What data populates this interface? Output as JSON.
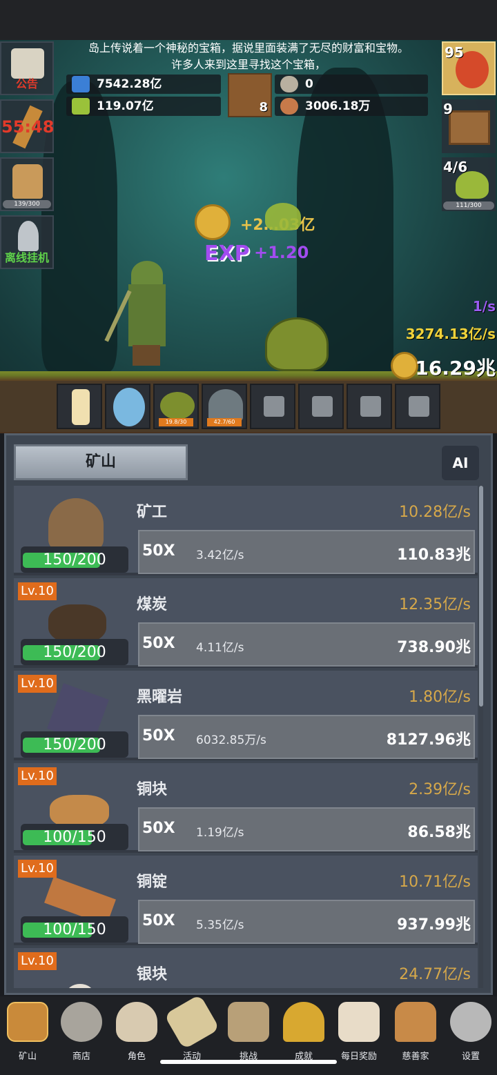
{
  "story": {
    "line1": "岛上传说着一个神秘的宝箱，据说里面装满了无尽的财富和宝物。",
    "line2": "许多人来到这里寻找这个宝箱，"
  },
  "resources": {
    "blue_potion": "7542.28亿",
    "green_potion": "119.07亿",
    "book_count": "8",
    "coin_top": "0",
    "meat": "3006.18万"
  },
  "left_buttons": {
    "notice_label": "公告",
    "timer_label": "55:48",
    "beer_progress": "139/300",
    "offline_label": "离线挂机"
  },
  "right_buttons": {
    "potion_count": "95",
    "chest_count": "9",
    "slime_count": "4/6",
    "slime_progress": "111/300"
  },
  "battle": {
    "gold_float": "+2…03亿",
    "exp_label": "EXP",
    "exp_value": "+1.20",
    "speed": "1/s",
    "gold_rate": "3274.13亿/s",
    "total_gold": "16.29兆"
  },
  "slots": [
    {
      "name": "candle"
    },
    {
      "name": "egg"
    },
    {
      "name": "slime",
      "progress": "19.8/30"
    },
    {
      "name": "ghost",
      "progress": "42.7/60"
    },
    {
      "name": "locked"
    },
    {
      "name": "locked"
    },
    {
      "name": "locked"
    },
    {
      "name": "locked"
    }
  ],
  "panel": {
    "tab_label": "矿山",
    "ai_label": "AI"
  },
  "mines": [
    {
      "name": "矿工",
      "level": "",
      "rate": "10.28亿/s",
      "progress": "150/200",
      "fill": 0.75,
      "mult": "50X",
      "per": "3.42亿/s",
      "cost": "110.83兆"
    },
    {
      "name": "煤炭",
      "level": "Lv.10",
      "rate": "12.35亿/s",
      "progress": "150/200",
      "fill": 0.75,
      "mult": "50X",
      "per": "4.11亿/s",
      "cost": "738.90兆"
    },
    {
      "name": "黑曜岩",
      "level": "Lv.10",
      "rate": "1.80亿/s",
      "progress": "150/200",
      "fill": 0.75,
      "mult": "50X",
      "per": "6032.85万/s",
      "cost": "8127.96兆"
    },
    {
      "name": "铜块",
      "level": "Lv.10",
      "rate": "2.39亿/s",
      "progress": "100/150",
      "fill": 0.67,
      "mult": "50X",
      "per": "1.19亿/s",
      "cost": "86.58兆"
    },
    {
      "name": "铜锭",
      "level": "Lv.10",
      "rate": "10.71亿/s",
      "progress": "100/150",
      "fill": 0.67,
      "mult": "50X",
      "per": "5.35亿/s",
      "cost": "937.99兆"
    },
    {
      "name": "银块",
      "level": "Lv.10",
      "rate": "24.77亿/s",
      "progress": "",
      "fill": 0,
      "mult": "",
      "per": "",
      "cost": ""
    }
  ],
  "nav": [
    {
      "label": "矿山",
      "icon": "lantern-icon"
    },
    {
      "label": "商店",
      "icon": "stone-icon"
    },
    {
      "label": "角色",
      "icon": "skull-icon"
    },
    {
      "label": "活动",
      "icon": "scroll-icon"
    },
    {
      "label": "挑战",
      "icon": "map-icon"
    },
    {
      "label": "成就",
      "icon": "key-icon"
    },
    {
      "label": "每日奖励",
      "icon": "envelope-icon"
    },
    {
      "label": "慈善家",
      "icon": "bread-icon"
    },
    {
      "label": "设置",
      "icon": "gear-icon"
    }
  ],
  "colors": {
    "accent_gold": "#d6a84a",
    "progress_green": "#3dbb55",
    "level_orange": "#e06c1c",
    "exp_purple": "#a24cf0"
  }
}
